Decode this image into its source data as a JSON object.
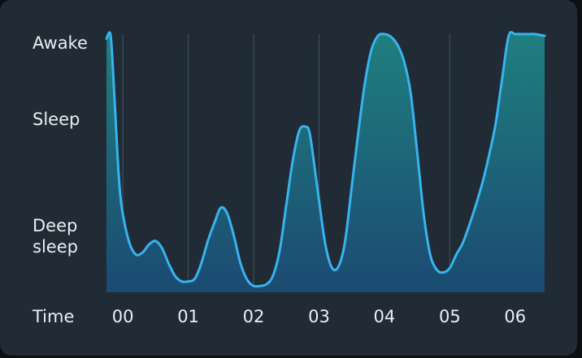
{
  "chart_data": {
    "type": "area",
    "title": "",
    "xlabel": "Time",
    "ylabel": "",
    "x_tick_labels": [
      "00",
      "01",
      "02",
      "03",
      "04",
      "05",
      "06"
    ],
    "y_levels": [
      {
        "value": 0,
        "label": "Deep\nsleep"
      },
      {
        "value": 1,
        "label": "Sleep"
      },
      {
        "value": 2,
        "label": "Awake"
      }
    ],
    "xlim": [
      -0.25,
      6.45
    ],
    "ylim": [
      -0.87,
      2.0
    ],
    "grid": "vertical",
    "series": [
      {
        "x": [
          -0.25,
          -0.19,
          -0.15,
          -0.1,
          -0.05,
          0.0,
          0.1,
          0.2,
          0.3,
          0.4,
          0.5,
          0.6,
          0.7,
          0.8,
          0.9,
          1.0,
          1.1,
          1.2,
          1.3,
          1.4,
          1.5,
          1.6,
          1.7,
          1.8,
          1.9,
          2.0,
          2.1,
          2.2,
          2.3,
          2.4,
          2.5,
          2.6,
          2.7,
          2.8,
          2.85,
          2.9,
          3.0,
          3.1,
          3.2,
          3.3,
          3.4,
          3.5,
          3.6,
          3.7,
          3.8,
          3.9,
          4.0,
          4.1,
          4.2,
          4.3,
          4.4,
          4.5,
          4.6,
          4.7,
          4.8,
          4.9,
          5.0,
          5.1,
          5.2,
          5.3,
          5.4,
          5.5,
          5.6,
          5.7,
          5.8,
          5.9,
          6.0,
          6.1,
          6.2,
          6.3,
          6.45
        ],
        "y": [
          1.95,
          2.0,
          1.6,
          0.9,
          0.3,
          0.0,
          -0.32,
          -0.45,
          -0.43,
          -0.34,
          -0.3,
          -0.38,
          -0.55,
          -0.69,
          -0.75,
          -0.75,
          -0.72,
          -0.55,
          -0.3,
          -0.1,
          0.07,
          0.0,
          -0.25,
          -0.55,
          -0.73,
          -0.8,
          -0.8,
          -0.78,
          -0.68,
          -0.4,
          0.1,
          0.6,
          0.93,
          0.97,
          0.92,
          0.7,
          0.15,
          -0.35,
          -0.6,
          -0.58,
          -0.3,
          0.3,
          0.9,
          1.45,
          1.82,
          1.98,
          2.0,
          1.97,
          1.88,
          1.7,
          1.35,
          0.7,
          0.0,
          -0.45,
          -0.62,
          -0.65,
          -0.6,
          -0.45,
          -0.32,
          -0.12,
          0.1,
          0.35,
          0.65,
          1.0,
          1.5,
          1.98,
          2.0,
          2.0,
          2.0,
          2.0,
          1.98
        ]
      }
    ],
    "colors": {
      "line": "#37b4ee",
      "fill_top": "#1f7f7f",
      "fill_bottom": "#1b4a72",
      "grid": "#445263",
      "text": "#e9eef2",
      "background": "#212b36"
    }
  }
}
